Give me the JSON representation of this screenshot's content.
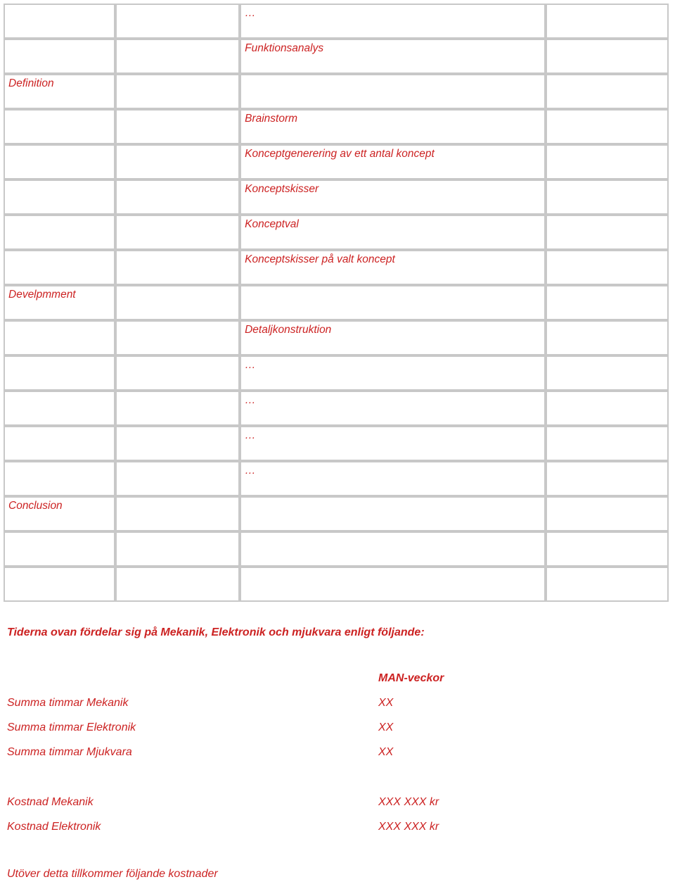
{
  "document": {
    "language": "sv",
    "text_color": "#cc2222",
    "border_color": "#c8c8c8"
  },
  "phase_table": {
    "rows": [
      {
        "phase": "",
        "spacer": "",
        "task": "…",
        "right": ""
      },
      {
        "phase": "",
        "spacer": "",
        "task": "Funktionsanalys",
        "right": ""
      },
      {
        "phase": "Definition",
        "spacer": "",
        "task": "",
        "right": ""
      },
      {
        "phase": "",
        "spacer": "",
        "task": "Brainstorm",
        "right": ""
      },
      {
        "phase": "",
        "spacer": "",
        "task": "Konceptgenerering av ett antal koncept",
        "right": ""
      },
      {
        "phase": "",
        "spacer": "",
        "task": "Konceptskisser",
        "right": ""
      },
      {
        "phase": "",
        "spacer": "",
        "task": "Konceptval",
        "right": ""
      },
      {
        "phase": "",
        "spacer": "",
        "task": "Konceptskisser på valt koncept",
        "right": ""
      },
      {
        "phase": "Develpmment",
        "spacer": "",
        "task": "",
        "right": ""
      },
      {
        "phase": "",
        "spacer": "",
        "task": "Detaljkonstruktion",
        "right": ""
      },
      {
        "phase": "",
        "spacer": "",
        "task": "…",
        "right": ""
      },
      {
        "phase": "",
        "spacer": "",
        "task": "…",
        "right": ""
      },
      {
        "phase": "",
        "spacer": "",
        "task": "…",
        "right": ""
      },
      {
        "phase": "",
        "spacer": "",
        "task": "…",
        "right": ""
      },
      {
        "phase": "Conclusion",
        "spacer": "",
        "task": "",
        "right": ""
      },
      {
        "phase": "",
        "spacer": "",
        "task": "",
        "right": ""
      },
      {
        "phase": "",
        "spacer": "",
        "task": "",
        "right": ""
      }
    ]
  },
  "intro": {
    "text": "Tiderna ovan fördelar sig på Mekanik, Elektronik och mjukvara enligt följande:"
  },
  "summary": {
    "header": {
      "label": "",
      "value": "MAN-veckor"
    },
    "hours": [
      {
        "label": "Summa timmar Mekanik",
        "value": "XX"
      },
      {
        "label": "Summa timmar Elektronik",
        "value": "XX"
      },
      {
        "label": "Summa timmar Mjukvara",
        "value": "XX"
      }
    ],
    "costs": [
      {
        "label": "Kostnad Mekanik",
        "value": "XXX XXX kr"
      },
      {
        "label": "Kostnad Elektronik",
        "value": "XXX XXX kr"
      }
    ]
  },
  "footer": {
    "text": "Utöver detta tillkommer följande kostnader"
  }
}
